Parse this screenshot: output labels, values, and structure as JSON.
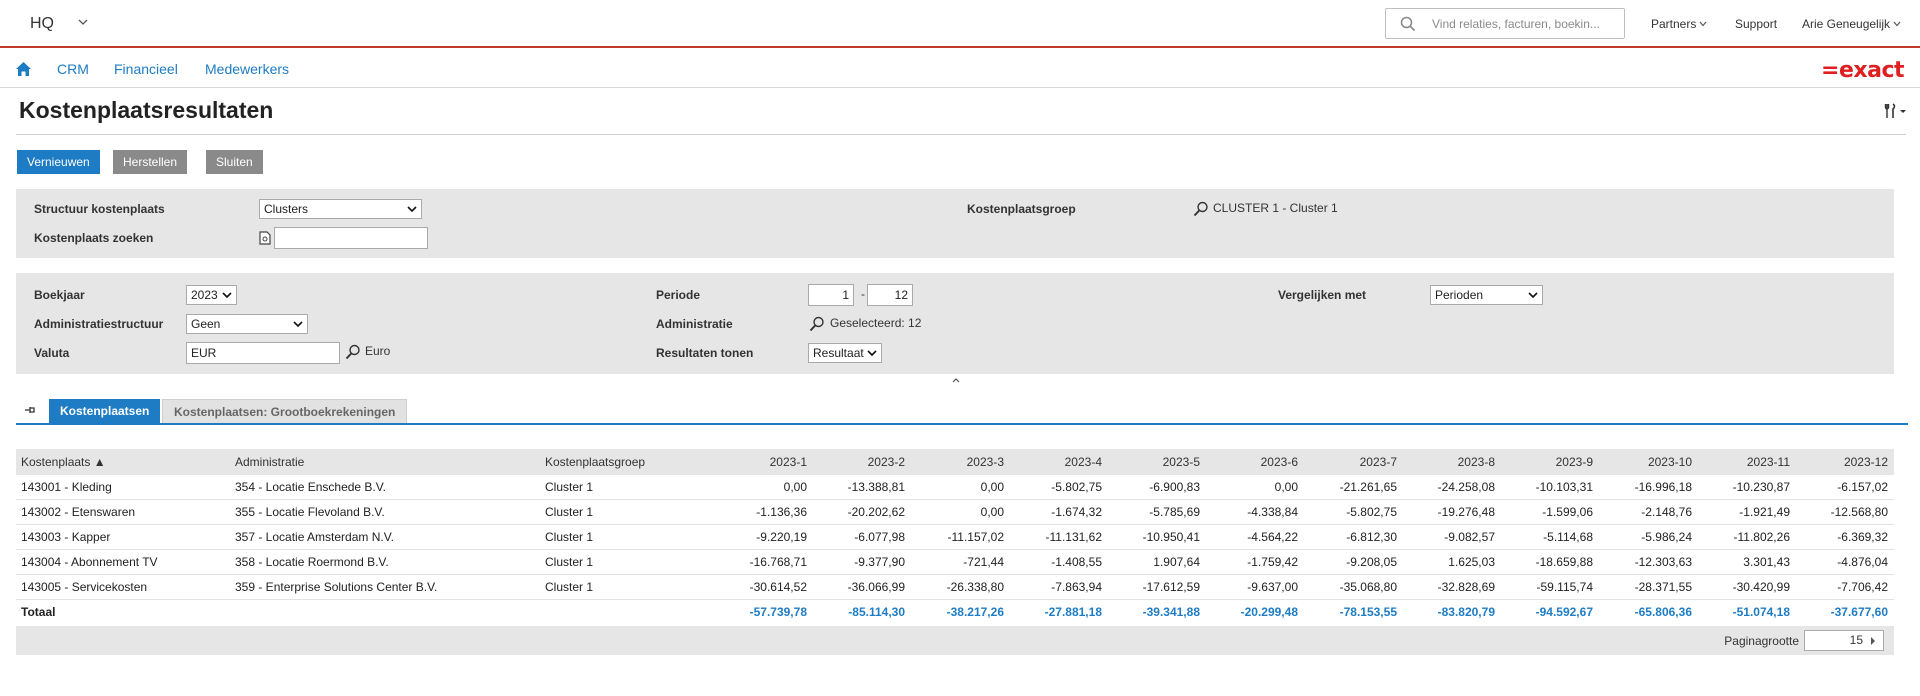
{
  "app": {
    "switcher_label": "HQ",
    "logo_text": "=exact"
  },
  "search": {
    "placeholder": "Vind relaties, facturen, boekin..."
  },
  "top_links": {
    "partners": "Partners",
    "support": "Support",
    "user": "Arie Geneugelijk"
  },
  "nav": {
    "items": [
      "CRM",
      "Financieel",
      "Medewerkers"
    ]
  },
  "page": {
    "title": "Kostenplaatsresultaten"
  },
  "buttons": {
    "refresh": "Vernieuwen",
    "reset": "Herstellen",
    "close": "Sluiten"
  },
  "filters1": {
    "structure_label": "Structuur kostenplaats",
    "structure_value": "Clusters",
    "search_label": "Kostenplaats zoeken",
    "search_value": "",
    "group_label": "Kostenplaatsgroep",
    "group_value": "CLUSTER 1 - Cluster 1"
  },
  "filters2": {
    "year_label": "Boekjaar",
    "year_value": "2023",
    "adminstruct_label": "Administratiestructuur",
    "adminstruct_value": "Geen",
    "currency_label": "Valuta",
    "currency_value": "EUR",
    "currency_name": "Euro",
    "period_label": "Periode",
    "period_from": "1",
    "period_sep": "-",
    "period_to": "12",
    "admin_label": "Administratie",
    "admin_value": "Geselecteerd: 12",
    "results_label": "Resultaten tonen",
    "results_value": "Resultaat",
    "compare_label": "Vergelijken met",
    "compare_value": "Perioden"
  },
  "tabs": {
    "active": "Kostenplaatsen",
    "other": "Kostenplaatsen: Grootboekrekeningen"
  },
  "table": {
    "headers": {
      "kostenplaats": "Kostenplaats ▲",
      "administratie": "Administratie",
      "groep": "Kostenplaatsgroep",
      "periods": [
        "2023-1",
        "2023-2",
        "2023-3",
        "2023-4",
        "2023-5",
        "2023-6",
        "2023-7",
        "2023-8",
        "2023-9",
        "2023-10",
        "2023-11",
        "2023-12"
      ]
    },
    "rows": [
      {
        "kostenplaats": "143001 - Kleding",
        "administratie": "354 - Locatie Enschede B.V.",
        "groep": "Cluster 1",
        "values": [
          "0,00",
          "-13.388,81",
          "0,00",
          "-5.802,75",
          "-6.900,83",
          "0,00",
          "-21.261,65",
          "-24.258,08",
          "-10.103,31",
          "-16.996,18",
          "-10.230,87",
          "-6.157,02"
        ]
      },
      {
        "kostenplaats": "143002 - Etenswaren",
        "administratie": "355 - Locatie Flevoland B.V.",
        "groep": "Cluster 1",
        "values": [
          "-1.136,36",
          "-20.202,62",
          "0,00",
          "-1.674,32",
          "-5.785,69",
          "-4.338,84",
          "-5.802,75",
          "-19.276,48",
          "-1.599,06",
          "-2.148,76",
          "-1.921,49",
          "-12.568,80"
        ]
      },
      {
        "kostenplaats": "143003 - Kapper",
        "administratie": "357 - Locatie Amsterdam N.V.",
        "groep": "Cluster 1",
        "values": [
          "-9.220,19",
          "-6.077,98",
          "-11.157,02",
          "-11.131,62",
          "-10.950,41",
          "-4.564,22",
          "-6.812,30",
          "-9.082,57",
          "-5.114,68",
          "-5.986,24",
          "-11.802,26",
          "-6.369,32"
        ]
      },
      {
        "kostenplaats": "143004 - Abonnement TV",
        "administratie": "358 - Locatie Roermond B.V.",
        "groep": "Cluster 1",
        "values": [
          "-16.768,71",
          "-9.377,90",
          "-721,44",
          "-1.408,55",
          "1.907,64",
          "-1.759,42",
          "-9.208,05",
          "1.625,03",
          "-18.659,88",
          "-12.303,63",
          "3.301,43",
          "-4.876,04"
        ]
      },
      {
        "kostenplaats": "143005 - Servicekosten",
        "administratie": "359 - Enterprise Solutions Center B.V.",
        "groep": "Cluster 1",
        "values": [
          "-30.614,52",
          "-36.066,99",
          "-26.338,80",
          "-7.863,94",
          "-17.612,59",
          "-9.637,00",
          "-35.068,80",
          "-32.828,69",
          "-59.115,74",
          "-28.371,55",
          "-30.420,99",
          "-7.706,42"
        ]
      }
    ],
    "total": {
      "label": "Totaal",
      "values": [
        "-57.739,78",
        "-85.114,30",
        "-38.217,26",
        "-27.881,18",
        "-39.341,88",
        "-20.299,48",
        "-78.153,55",
        "-83.820,79",
        "-94.592,67",
        "-65.806,36",
        "-51.074,18",
        "-37.677,60"
      ]
    }
  },
  "paging": {
    "label": "Paginagrootte",
    "size": "15"
  }
}
